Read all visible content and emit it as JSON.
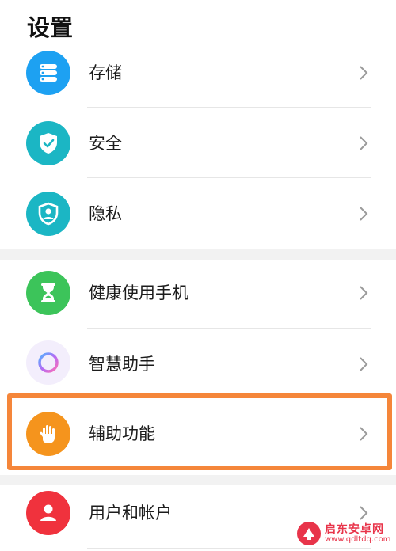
{
  "header": {
    "title": "设置"
  },
  "items": [
    {
      "label": "存储",
      "icon": "storage-icon",
      "color": "#1da1f2"
    },
    {
      "label": "安全",
      "icon": "shield-check-icon",
      "color": "#1bb6c4"
    },
    {
      "label": "隐私",
      "icon": "privacy-shield-icon",
      "color": "#1bb6c4"
    },
    {
      "label": "健康使用手机",
      "icon": "hourglass-icon",
      "color": "#3cc45a"
    },
    {
      "label": "智慧助手",
      "icon": "assistant-ring-icon",
      "color": "#9b6cf2"
    },
    {
      "label": "辅助功能",
      "icon": "hand-icon",
      "color": "#f5941d"
    },
    {
      "label": "用户和帐户",
      "icon": "user-icon",
      "color": "#f0323d"
    }
  ],
  "highlight": {
    "color": "#f5863a",
    "target": "辅助功能"
  },
  "watermark": {
    "name": "启东安卓网",
    "url": "www.qdltdq.com"
  }
}
